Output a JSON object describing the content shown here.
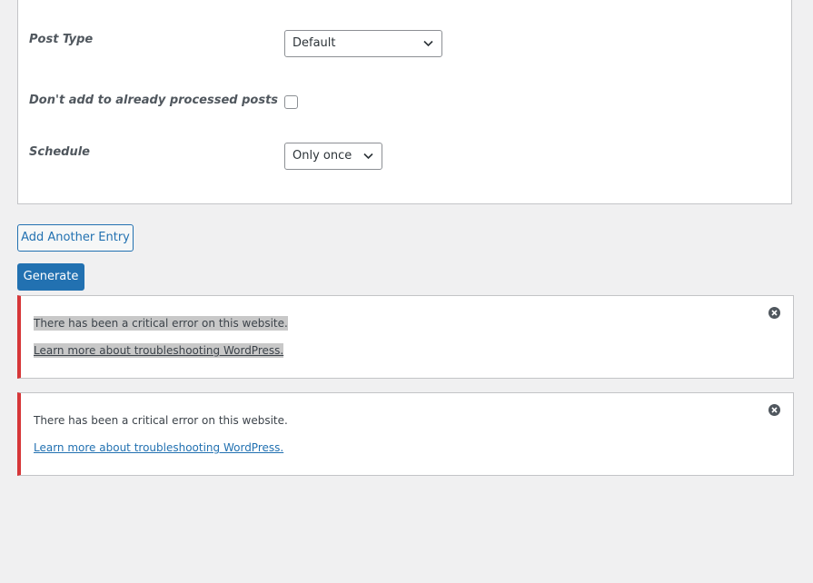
{
  "form": {
    "post_type": {
      "label": "Post Type",
      "value": "Default"
    },
    "dont_add_processed": {
      "label": "Don't add to already processed posts",
      "checked": false
    },
    "schedule": {
      "label": "Schedule",
      "value": "Only once"
    }
  },
  "actions": {
    "add_entry_label": "Add Another Entry",
    "generate_label": "Generate"
  },
  "notices": [
    {
      "message": "There has been a critical error on this website.",
      "link_text": "Learn more about troubleshooting WordPress.",
      "selected": true
    },
    {
      "message": "There has been a critical error on this website.",
      "link_text": "Learn more about troubleshooting WordPress.",
      "selected": false
    }
  ],
  "icons": {
    "select_arrow": "chevron-down-icon",
    "dismiss": "dismiss-icon"
  },
  "colors": {
    "accent": "#2271b1",
    "error": "#d63638",
    "background": "#f0f0f1",
    "text_selection": "#c8c8c8"
  }
}
